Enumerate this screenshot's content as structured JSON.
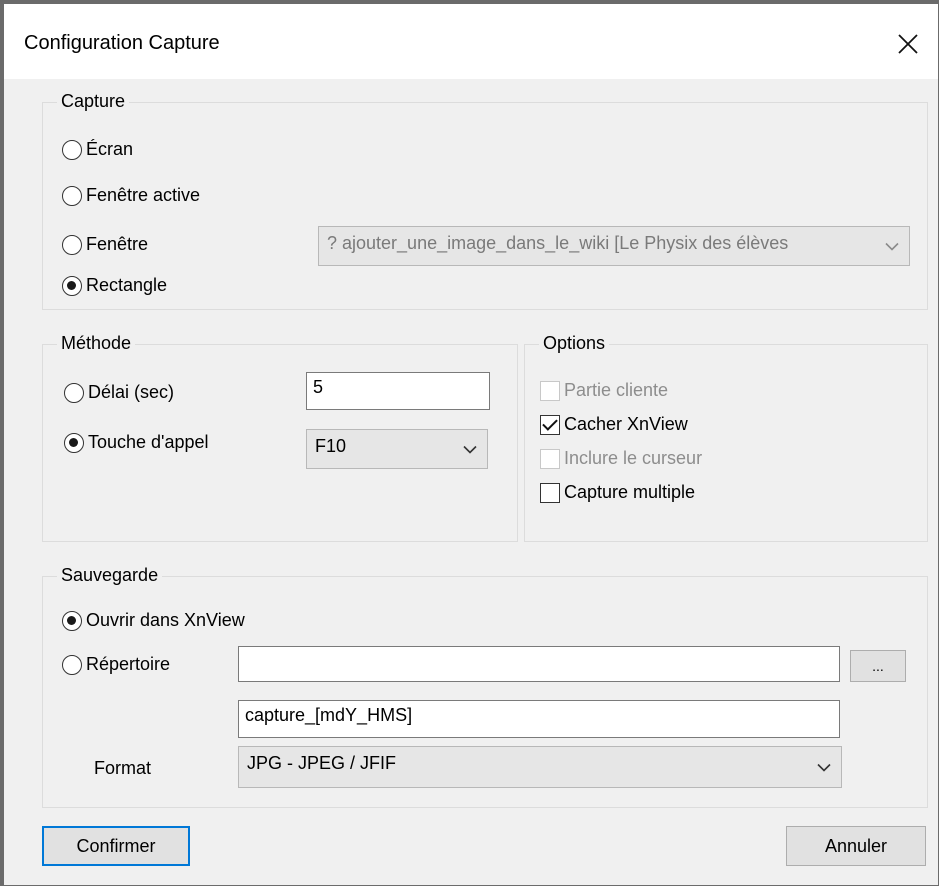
{
  "window": {
    "title": "Configuration Capture"
  },
  "capture": {
    "label": "Capture",
    "options": [
      "Écran",
      "Fenêtre active",
      "Fenêtre",
      "Rectangle"
    ],
    "selected": "Rectangle",
    "window_select_value": "? ajouter_une_image_dans_le_wiki [Le Physix des élèves"
  },
  "methode": {
    "label": "Méthode",
    "delay_label": "Délai (sec)",
    "delay_value": "5",
    "hotkey_label": "Touche d'appel",
    "hotkey_value": "F10",
    "selected": "Touche d'appel"
  },
  "options": {
    "label": "Options",
    "items": [
      {
        "label": "Partie cliente",
        "checked": false,
        "disabled": true
      },
      {
        "label": "Cacher XnView",
        "checked": true,
        "disabled": false
      },
      {
        "label": "Inclure le curseur",
        "checked": false,
        "disabled": true
      },
      {
        "label": "Capture multiple",
        "checked": false,
        "disabled": false
      }
    ]
  },
  "sauvegarde": {
    "label": "Sauvegarde",
    "open_label": "Ouvrir dans XnView",
    "dir_label": "Répertoire",
    "dir_value": "",
    "browse_label": "...",
    "filename_value": "capture_[mdY_HMS]",
    "format_label": "Format",
    "format_value": "JPG - JPEG / JFIF",
    "selected": "Ouvrir dans XnView"
  },
  "buttons": {
    "confirm": "Confirmer",
    "cancel": "Annuler"
  }
}
